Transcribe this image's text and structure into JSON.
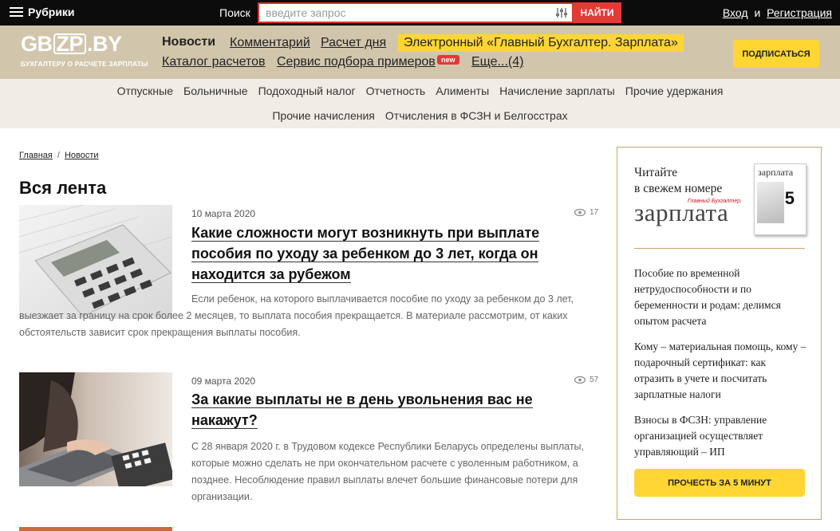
{
  "topbar": {
    "menu_label": "Рубрики",
    "search_label": "Поиск",
    "search_placeholder": "введите запрос",
    "search_button": "НАЙТИ",
    "login": "Вход",
    "and": "и",
    "register": "Регистрация"
  },
  "header": {
    "logo_main_left": "GB",
    "logo_main_zp": "ZP",
    "logo_main_right": ".BY",
    "logo_tagline": "БУХГАЛТЕРУ О РАСЧЕТЕ ЗАРПЛАТЫ",
    "nav": {
      "news": "Новости",
      "comments": "Комментарий",
      "calc_day": "Расчет дня",
      "promo": "Электронный «Главный Бухгалтер. Зарплата»",
      "catalog": "Каталог расчетов",
      "examples": "Сервис подбора примеров",
      "new_badge": "new",
      "more": "Еще...(4)"
    },
    "subscribe": "ПОДПИСАТЬСЯ"
  },
  "rubrics": {
    "row1": [
      "Отпускные",
      "Больничные",
      "Подоходный налог",
      "Отчетность",
      "Алименты",
      "Начисление зарплаты",
      "Прочие удержания"
    ],
    "row2": [
      "Прочие начисления",
      "Отчисления в ФСЗН и Белгосстрах"
    ]
  },
  "breadcrumb": {
    "home": "Главная",
    "separator": "/",
    "current": "Новости"
  },
  "page_title": "Вся лента",
  "articles": [
    {
      "date": "10 марта 2020",
      "views": "17",
      "title": "Какие сложности могут возникнуть при выплате пособия по уходу за ребенком до 3 лет, когда он находится за рубежом",
      "text": "Если ребенок, на которого выплачивается пособие по уходу за ребенком до 3 лет, выезжает за границу на срок более 2 месяцев, то выплата пособия прекращается. В материале рассмотрим, от каких обстоятельств зависит срок прекращения выплаты пособия."
    },
    {
      "date": "09 марта 2020",
      "views": "57",
      "title": "За какие выплаты не в день увольнения вас не накажут?",
      "text": "С 28 января 2020 г. в Трудовом кодексе Республики Беларусь определены выплаты, которые можно сделать не при окончательном расчете с уволенным работником, а позднее. Несоблюдение правил выплаты влечет большие финансовые потери для организации."
    }
  ],
  "sidebar": {
    "heading_line1": "Читайте",
    "heading_line2": "в свежем номере",
    "brand": "зарплата",
    "brand_small": "Главный Бухгалтер.",
    "cover_title": "зарплата",
    "cover_number": "5",
    "items": [
      "Пособие по временной нетрудоспособности и по беременности и родам: делимся опытом расчета",
      "Кому – материальная помощь, кому – подарочный сертификат: как отразить в учете и посчитать зарплатные налоги",
      "Взносы в ФСЗН: управление организацией осуществляет управляющий – ИП"
    ],
    "read_button": "ПРОЧЕСТЬ ЗА 5 МИНУТ"
  },
  "colors": {
    "topbar": "#0c0c0c",
    "header": "#d1c6ac",
    "accent_red": "#e53935",
    "accent_yellow": "#ffd633",
    "sidebar_border": "#c9a56a"
  }
}
